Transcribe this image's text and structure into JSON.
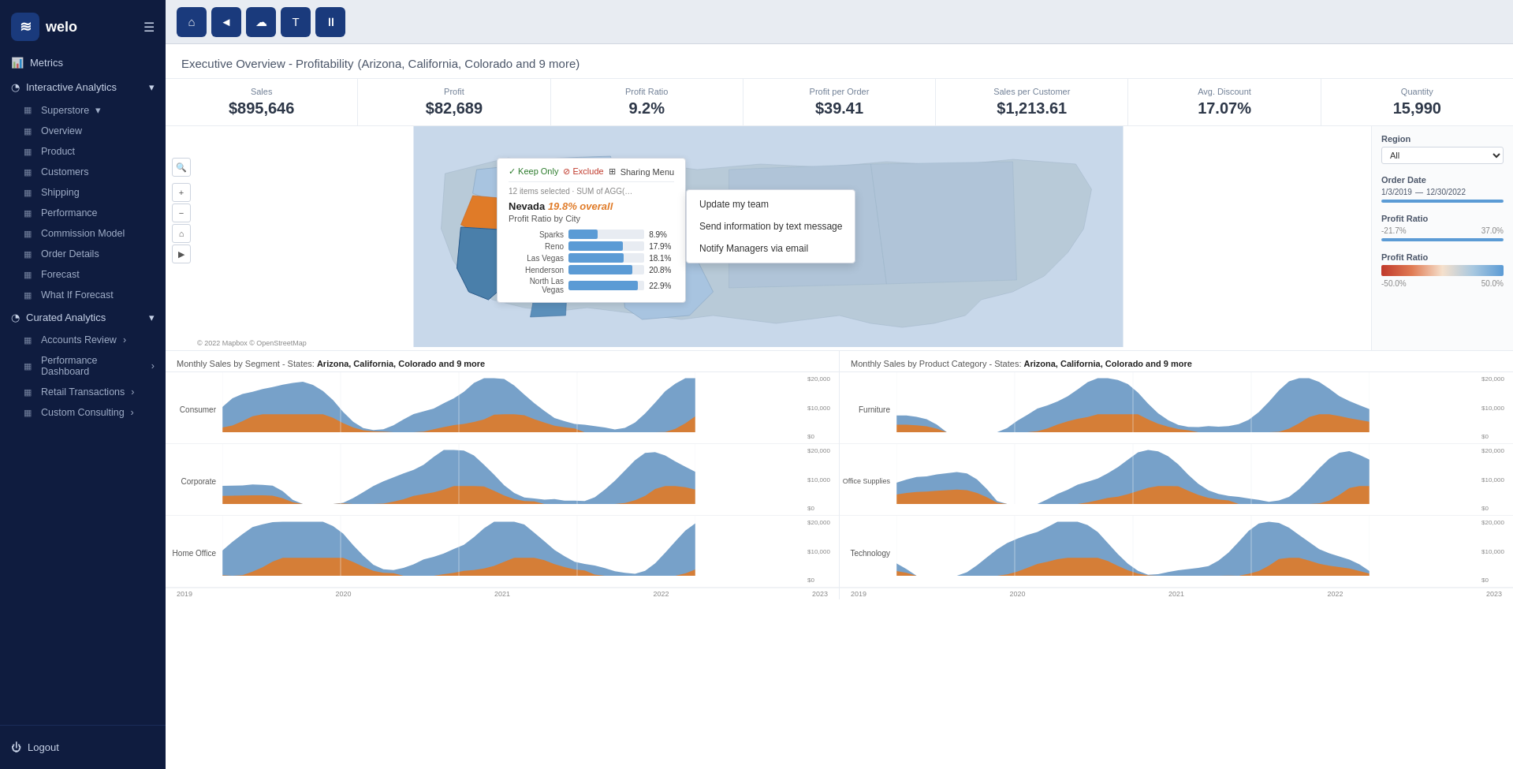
{
  "sidebar": {
    "logo": "welo",
    "logo_icon": "≋",
    "metrics_label": "Metrics",
    "interactive_analytics_label": "Interactive Analytics",
    "superstore_label": "Superstore",
    "sub_items": [
      {
        "label": "Overview",
        "icon": "▦"
      },
      {
        "label": "Product",
        "icon": "▦"
      },
      {
        "label": "Customers",
        "icon": "▦"
      },
      {
        "label": "Shipping",
        "icon": "▦"
      },
      {
        "label": "Performance",
        "icon": "▦"
      },
      {
        "label": "Commission Model",
        "icon": "▦"
      },
      {
        "label": "Order Details",
        "icon": "▦"
      },
      {
        "label": "Forecast",
        "icon": "▦"
      },
      {
        "label": "What If Forecast",
        "icon": "▦"
      }
    ],
    "curated_analytics_label": "Curated Analytics",
    "curated_items": [
      {
        "label": "Accounts Review",
        "icon": "▦"
      },
      {
        "label": "Performance Dashboard",
        "icon": "▦"
      },
      {
        "label": "Retail Transactions",
        "icon": "▦"
      },
      {
        "label": "Custom Consulting",
        "icon": "▦"
      }
    ],
    "logout_label": "Logout"
  },
  "toolbar": {
    "buttons": [
      {
        "icon": "⌂",
        "name": "home"
      },
      {
        "icon": "◄",
        "name": "back"
      },
      {
        "icon": "☁",
        "name": "cloud"
      },
      {
        "icon": "T",
        "name": "text"
      },
      {
        "icon": "⏸",
        "name": "pause"
      }
    ]
  },
  "dashboard": {
    "title": "Executive Overview - Profitability",
    "subtitle": "(Arizona, California, Colorado and 9 more)",
    "kpis": [
      {
        "label": "Sales",
        "value": "$895,646"
      },
      {
        "label": "Profit",
        "value": "$82,689"
      },
      {
        "label": "Profit Ratio",
        "value": "9.2%"
      },
      {
        "label": "Profit per Order",
        "value": "$39.41"
      },
      {
        "label": "Sales per Customer",
        "value": "$1,213.61"
      },
      {
        "label": "Avg. Discount",
        "value": "17.07%"
      },
      {
        "label": "Quantity",
        "value": "15,990"
      }
    ],
    "map": {
      "copyright": "© 2022 Mapbox © OpenStreetMap"
    },
    "popup": {
      "toolbar_items": [
        "✓ Keep Only",
        "⊘ Exclude",
        "⊞",
        "Sharing Menu"
      ],
      "sub_label": "12 items selected · SUM of AGG(…",
      "state": "Nevada",
      "overall": "19.8% overall",
      "subtitle": "Profit Ratio by City",
      "bars": [
        {
          "city": "Sparks",
          "pct": 8.9,
          "width": 38
        },
        {
          "city": "Reno",
          "pct": 17.9,
          "width": 72
        },
        {
          "city": "Las Vegas",
          "pct": 18.1,
          "width": 73
        },
        {
          "city": "Henderson",
          "pct": 20.8,
          "width": 84
        },
        {
          "city": "North Las Vegas",
          "pct": 22.9,
          "width": 92
        }
      ]
    },
    "context_menu": [
      "Update my team",
      "Send information by text message",
      "Notify Managers via email"
    ],
    "filters": {
      "region_label": "Region",
      "region_value": "(All)",
      "order_date_label": "Order Date",
      "date_start": "1/3/2019",
      "date_end": "12/30/2022",
      "profit_ratio_label": "Profit Ratio",
      "profit_ratio_min": "-21.7%",
      "profit_ratio_max": "37.0%",
      "profit_ratio_color_label": "Profit Ratio",
      "color_min": "-50.0%",
      "color_max": "50.0%"
    },
    "segment_chart": {
      "title": "Monthly Sales by Segment - States: ",
      "states": "Arizona, California, Colorado and 9 more",
      "segments": [
        "Consumer",
        "Corporate",
        "Home Office"
      ],
      "years": [
        "2019",
        "2020",
        "2021",
        "2022",
        "2023"
      ]
    },
    "category_chart": {
      "title": "Monthly Sales by Product Category - States: ",
      "states": "Arizona, California, Colorado and 9 more",
      "categories": [
        "Furniture",
        "Office Supplies",
        "Technology"
      ],
      "years": [
        "2019",
        "2020",
        "2021",
        "2022",
        "2023"
      ]
    }
  }
}
